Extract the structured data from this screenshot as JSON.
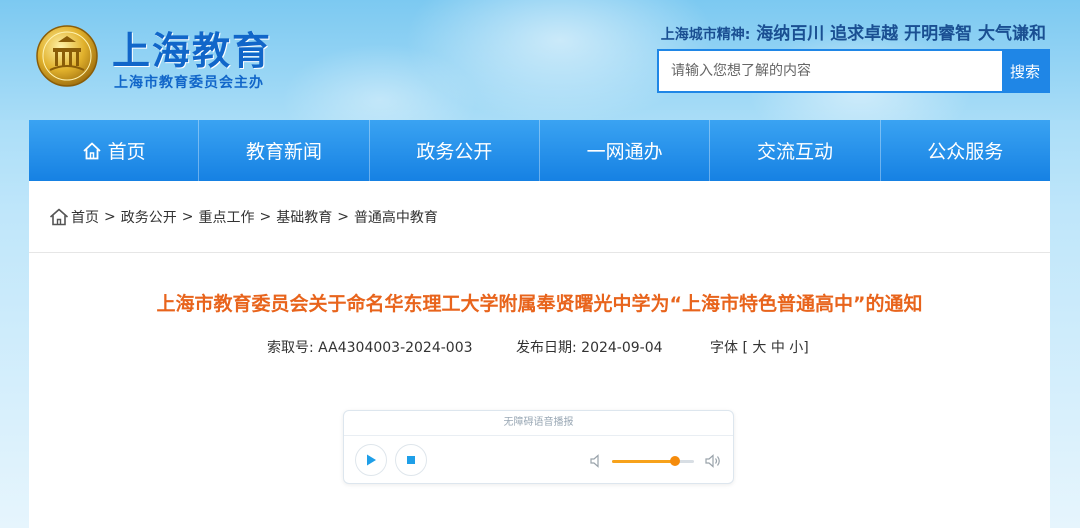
{
  "header": {
    "logo_title": "上海教育",
    "logo_subtitle": "上海市教育委员会主办",
    "spirit_label": "上海城市精神:",
    "spirit_value": " 海纳百川 追求卓越 开明睿智 大气谦和",
    "search_placeholder": "请输入您想了解的内容",
    "search_button": "搜索"
  },
  "nav": {
    "items": [
      {
        "label": "首页",
        "icon": "home-icon"
      },
      {
        "label": "教育新闻"
      },
      {
        "label": "政务公开"
      },
      {
        "label": "一网通办"
      },
      {
        "label": "交流互动"
      },
      {
        "label": "公众服务"
      }
    ]
  },
  "breadcrumb": {
    "items": [
      "首页",
      "政务公开",
      "重点工作",
      "基础教育",
      "普通高中教育"
    ],
    "separator": ">"
  },
  "article": {
    "title": "上海市教育委员会关于命名华东理工大学附属奉贤曙光中学为“上海市特色普通高中”的通知",
    "index_label": "索取号:",
    "index_value": "AA4304003-2024-003",
    "date_label": "发布日期:",
    "date_value": "2024-09-04",
    "font_label": "字体",
    "font_open": "[",
    "font_large": "大",
    "font_medium": "中",
    "font_small": "小",
    "font_close": "]"
  },
  "player": {
    "title": "无障碍语音播报",
    "volume": 0.77
  },
  "colors": {
    "brand_blue": "#1166c9",
    "nav_blue": "#1f86e6",
    "title_orange": "#e8641c",
    "volume_orange": "#f58b0b"
  }
}
